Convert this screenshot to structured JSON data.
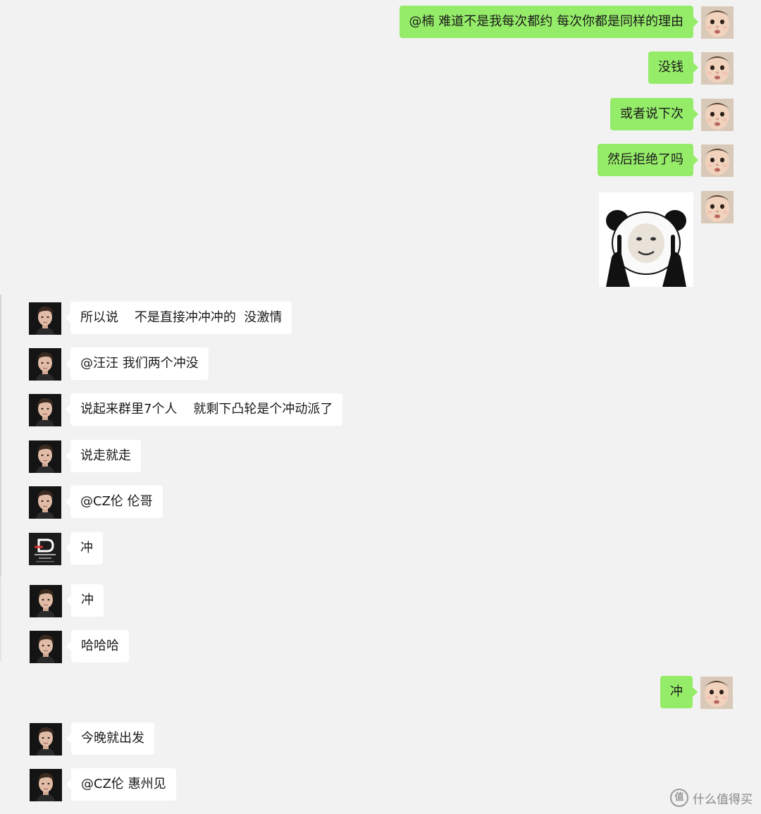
{
  "chat": {
    "messages": [
      {
        "side": "out",
        "type": "text",
        "text": "@楠 难道不是我每次都约 每次你都是同样的理由",
        "avatar": "baby-face-avatar"
      },
      {
        "side": "out",
        "type": "text",
        "text": "没钱",
        "avatar": "baby-face-avatar"
      },
      {
        "side": "out",
        "type": "text",
        "text": "或者说下次",
        "avatar": "baby-face-avatar"
      },
      {
        "side": "out",
        "type": "text",
        "text": "然后拒绝了吗",
        "avatar": "baby-face-avatar"
      },
      {
        "side": "out",
        "type": "sticker",
        "sticker": "panda-meme-sticker",
        "avatar": "baby-face-avatar"
      },
      {
        "side": "in",
        "type": "text",
        "text": "所以说    不是直接冲冲冲的  没激情",
        "avatar": "man-portrait-avatar"
      },
      {
        "side": "in",
        "type": "text",
        "text": "@汪汪 我们两个冲没",
        "avatar": "man-portrait-avatar"
      },
      {
        "side": "in",
        "type": "text",
        "text": "说起来群里7个人    就剩下凸轮是个冲动派了",
        "avatar": "man-portrait-avatar"
      },
      {
        "side": "in",
        "type": "text",
        "text": "说走就走",
        "avatar": "man-portrait-avatar"
      },
      {
        "side": "in",
        "type": "text",
        "text": "@CZ伦 伦哥",
        "avatar": "man-portrait-avatar"
      },
      {
        "side": "in",
        "type": "text",
        "text": "冲",
        "avatar": "dark-logo-avatar"
      },
      {
        "side": "in",
        "type": "text",
        "text": "冲",
        "avatar": "man-portrait-avatar"
      },
      {
        "side": "in",
        "type": "text",
        "text": "哈哈哈",
        "avatar": "man-portrait-avatar"
      },
      {
        "side": "out",
        "type": "text",
        "text": "冲",
        "avatar": "baby-face-avatar"
      },
      {
        "side": "in",
        "type": "text",
        "text": "今晚就出发",
        "avatar": "man-portrait-avatar"
      },
      {
        "side": "in",
        "type": "text",
        "text": "@CZ伦 惠州见",
        "avatar": "man-portrait-avatar"
      }
    ]
  },
  "watermark": {
    "icon_text": "值",
    "text": "什么值得买"
  },
  "colors": {
    "background": "#f2f2f2",
    "outgoing_bubble": "#95ec69",
    "incoming_bubble": "#ffffff"
  }
}
